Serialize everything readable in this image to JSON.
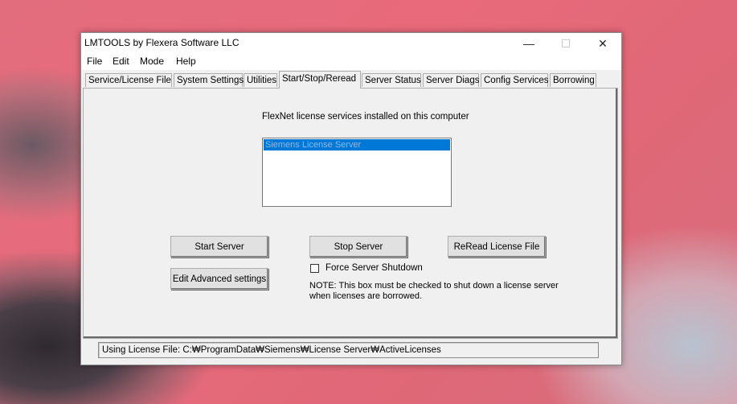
{
  "window": {
    "title": "LMTOOLS by Flexera Software LLC",
    "controls": {
      "minimize": "—",
      "maximize": "☐",
      "close": "✕"
    }
  },
  "menu": [
    "File",
    "Edit",
    "Mode",
    "Help"
  ],
  "tabs": [
    {
      "label": "Service/License File"
    },
    {
      "label": "System Settings"
    },
    {
      "label": "Utilities"
    },
    {
      "label": "Start/Stop/Reread",
      "active": true
    },
    {
      "label": "Server Status"
    },
    {
      "label": "Server Diags"
    },
    {
      "label": "Config Services"
    },
    {
      "label": "Borrowing"
    }
  ],
  "panel": {
    "caption": "FlexNet license services installed on this computer",
    "services": [
      "Siemens License Server"
    ],
    "selected_service": "Siemens License Server",
    "buttons": {
      "start": "Start Server",
      "stop": "Stop Server",
      "reread": "ReRead License File",
      "advanced": "Edit Advanced settings"
    },
    "force_shutdown": {
      "label": "Force Server Shutdown",
      "checked": false
    },
    "note_line1": "NOTE:  This box must be checked to shut down a license server",
    "note_line2": "when licenses are borrowed."
  },
  "status": {
    "text": "Using License File:  C:₩ProgramData₩Siemens₩License Server₩ActiveLicenses"
  },
  "colors": {
    "selection": "#0078d7",
    "window_bg": "#f0f0f0",
    "desktop_accent": "#e26d7d"
  }
}
